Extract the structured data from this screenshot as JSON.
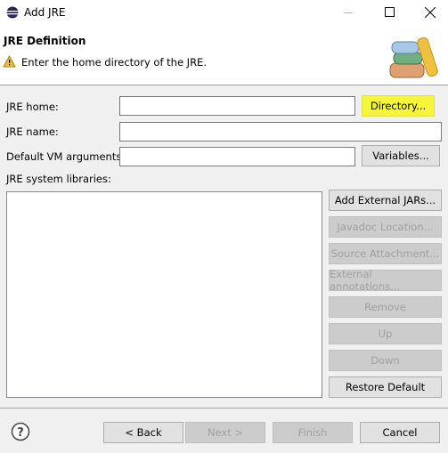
{
  "window": {
    "title": "Add JRE"
  },
  "header": {
    "title": "JRE Definition",
    "message": "Enter the home directory of the JRE."
  },
  "form": {
    "jre_home_label": "JRE home:",
    "jre_home_value": "",
    "directory_button": "Directory...",
    "jre_name_label": "JRE name:",
    "jre_name_value": "",
    "vm_args_label": "Default VM arguments:",
    "vm_args_value": "",
    "variables_button": "Variables...",
    "libraries_label": "JRE system libraries:"
  },
  "library_buttons": [
    {
      "label": "Add External JARs...",
      "enabled": true
    },
    {
      "label": "Javadoc Location...",
      "enabled": false
    },
    {
      "label": "Source Attachment...",
      "enabled": false
    },
    {
      "label": "External annotations...",
      "enabled": false
    },
    {
      "label": "Remove",
      "enabled": false
    },
    {
      "label": "Up",
      "enabled": false
    },
    {
      "label": "Down",
      "enabled": false
    },
    {
      "label": "Restore Default",
      "enabled": true
    }
  ],
  "footer": {
    "back": "< Back",
    "next": "Next >",
    "finish": "Finish",
    "cancel": "Cancel"
  },
  "colors": {
    "highlight": "#f5f53a",
    "warning": "#f0c030"
  }
}
